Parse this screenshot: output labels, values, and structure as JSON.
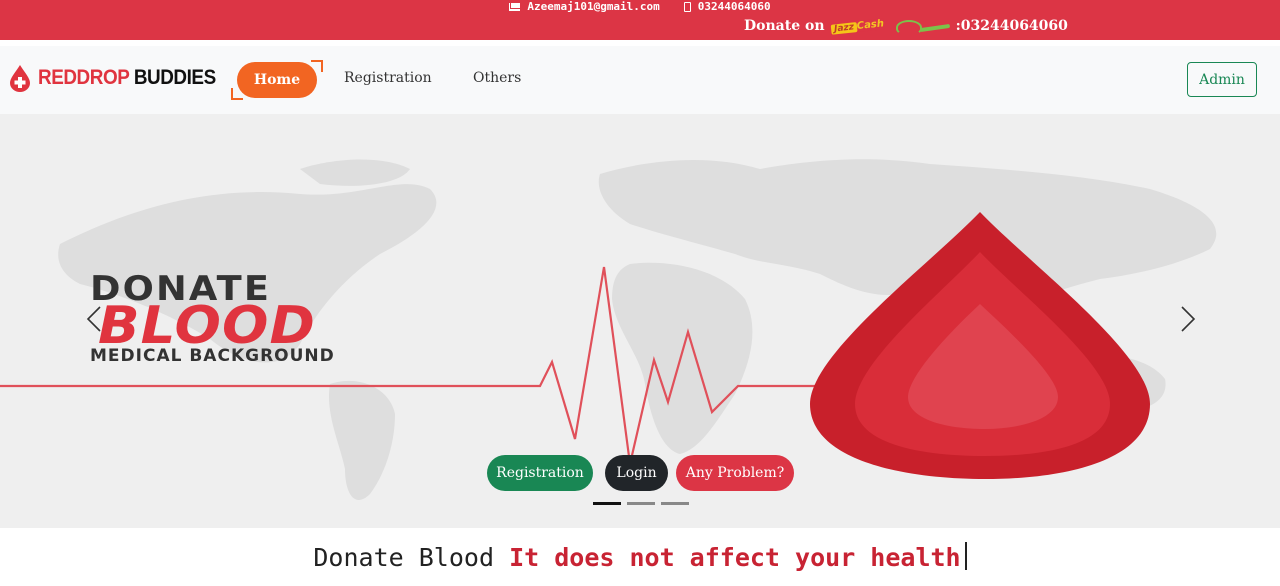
{
  "topbar": {
    "email": "Azeemaj101@gmail.com",
    "phone": "03244064060",
    "donate_label": "Donate on",
    "jazzcash_label": "Jazz",
    "jazzcash_suffix": "Cash",
    "donate_number": ":03244064060",
    "bg_color": "#dc3545"
  },
  "navbar": {
    "brand_red": "REDDROP",
    "brand_dark": "BUDDIES",
    "links": {
      "home": "Home",
      "registration": "Registration",
      "others": "Others"
    },
    "admin_label": "Admin"
  },
  "carousel": {
    "slide": {
      "line1": "DONATE",
      "line2": "BLOOD",
      "line3": "MEDICAL BACKGROUND"
    },
    "buttons": {
      "registration": "Registration",
      "login": "Login",
      "problem": "Any Problem?"
    },
    "indicators_count": 3,
    "active_indicator": 1,
    "colors": {
      "registration": "#198754",
      "login": "#212529",
      "problem": "#dc3545",
      "accent": "#e0343f"
    }
  },
  "tagline": {
    "static": "Donate Blood",
    "typed": "It does not affect your health"
  }
}
